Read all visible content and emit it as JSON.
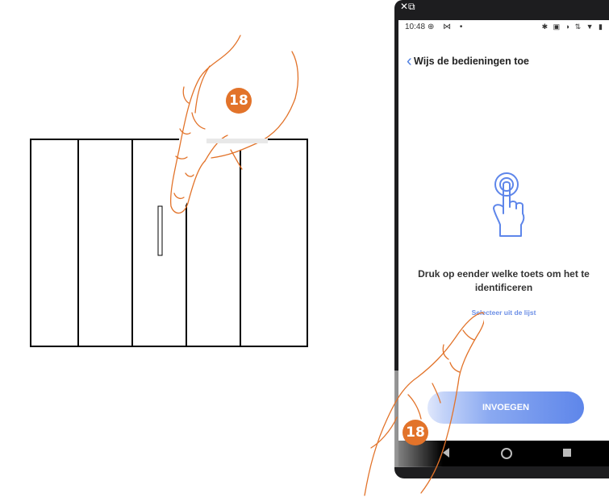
{
  "step_number": "18",
  "status_bar": {
    "time": "10:48",
    "left_icons": "⊕ ⋈ •",
    "right_icons": "✱ ▣ ◑ ⇅ ▼ ▮"
  },
  "top_strip_icons": "✕⧉",
  "header": {
    "back_icon": "‹",
    "title": "Wijs de bedieningen toe"
  },
  "main": {
    "icon": "touch-hand-icon",
    "prompt": "Druk op eender welke toets om het te identificeren",
    "link": "Selecteer uit de lijst"
  },
  "button": {
    "label": "INVOEGEN"
  },
  "colors": {
    "accent": "#5e86ea",
    "badge": "#e2732a",
    "hand_outline": "#e2732a"
  }
}
